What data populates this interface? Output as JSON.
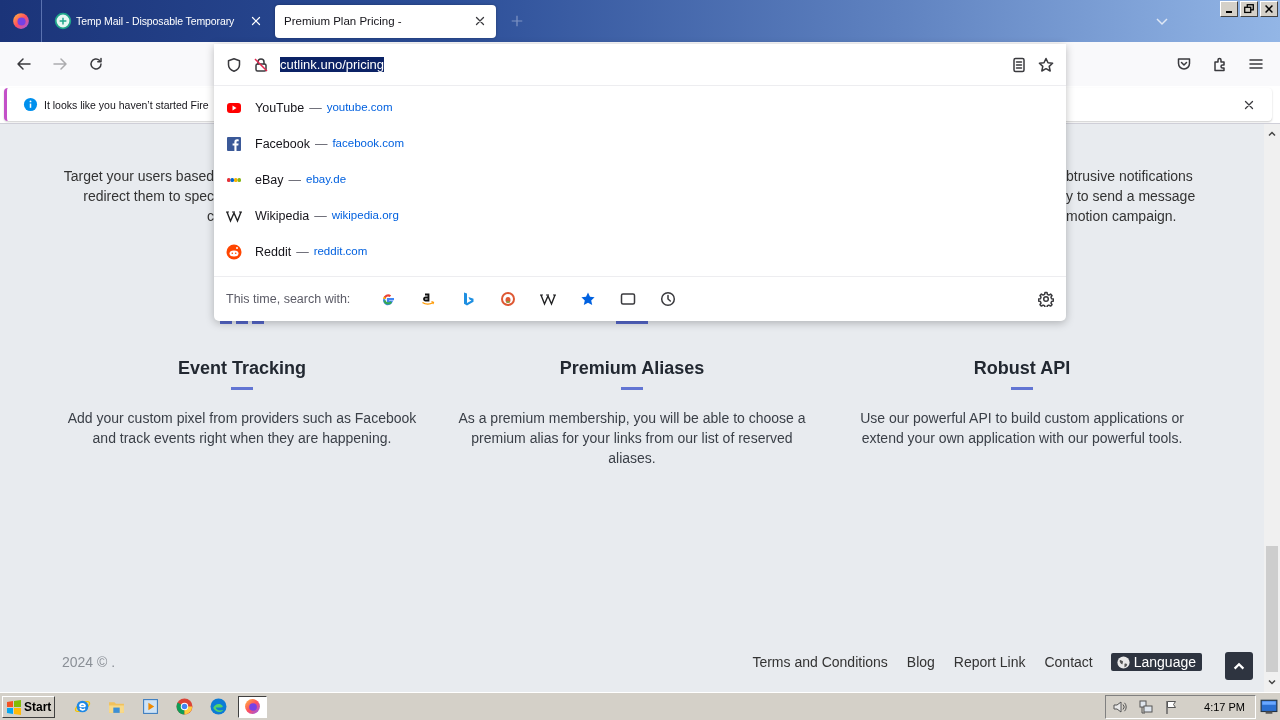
{
  "tabs": [
    {
      "title": "Temp Mail - Disposable Temporary",
      "selected": false
    },
    {
      "title": "Premium Plan Pricing -",
      "selected": true
    }
  ],
  "nav_buttons": [
    {
      "kind": "back",
      "disabled": false
    },
    {
      "kind": "forward",
      "disabled": true
    },
    {
      "kind": "reload",
      "disabled": false
    }
  ],
  "url_bar": {
    "value": "cutlink.uno/pricing",
    "selected": true
  },
  "suggestions": [
    {
      "kind": "youtube",
      "title": "YouTube",
      "separator": "—",
      "url": "youtube.com"
    },
    {
      "kind": "facebook",
      "title": "Facebook",
      "separator": "—",
      "url": "facebook.com"
    },
    {
      "kind": "ebay",
      "title": "eBay",
      "separator": "—",
      "url": "ebay.de"
    },
    {
      "kind": "wikipedia",
      "title": "Wikipedia",
      "separator": "—",
      "url": "wikipedia.org"
    },
    {
      "kind": "reddit",
      "title": "Reddit",
      "separator": "—",
      "url": "reddit.com"
    }
  ],
  "search_bar": {
    "label": "This time, search with:",
    "engines": [
      {
        "kind": "google"
      },
      {
        "kind": "amazon"
      },
      {
        "kind": "bing"
      },
      {
        "kind": "duckduckgo"
      },
      {
        "kind": "wikipedia"
      },
      {
        "kind": "bookmarks"
      },
      {
        "kind": "tabs"
      },
      {
        "kind": "history"
      }
    ]
  },
  "notification": {
    "text": "It looks like you haven’t started Fire"
  },
  "page": {
    "partial_left": [
      "Target your users based",
      "redirect them to spec",
      "c"
    ],
    "partial_right": [
      "btrusive notifications",
      "y to send a message",
      "motion campaign."
    ],
    "features": [
      {
        "title": "Event Tracking",
        "text": "Add your custom pixel from providers such as Facebook and track events right when they are happening."
      },
      {
        "title": "Premium Aliases",
        "text": "As a premium membership, you will be able to choose a premium alias for your links from our list of reserved aliases."
      },
      {
        "title": "Robust API",
        "text": "Use our powerful API to build custom applications or extend your own application with our powerful tools."
      }
    ],
    "footer": {
      "copyright": "2024 © .",
      "links": [
        "Terms and Conditions",
        "Blog",
        "Report Link",
        "Contact"
      ],
      "language": "Language"
    }
  },
  "taskbar": {
    "start": "Start",
    "apps": [
      {
        "kind": "ie",
        "active": false
      },
      {
        "kind": "folder",
        "active": false
      },
      {
        "kind": "media",
        "active": false
      },
      {
        "kind": "chrome",
        "active": false
      },
      {
        "kind": "edge",
        "active": false
      },
      {
        "kind": "firefox",
        "active": true
      }
    ],
    "clock": "4:17 PM"
  }
}
